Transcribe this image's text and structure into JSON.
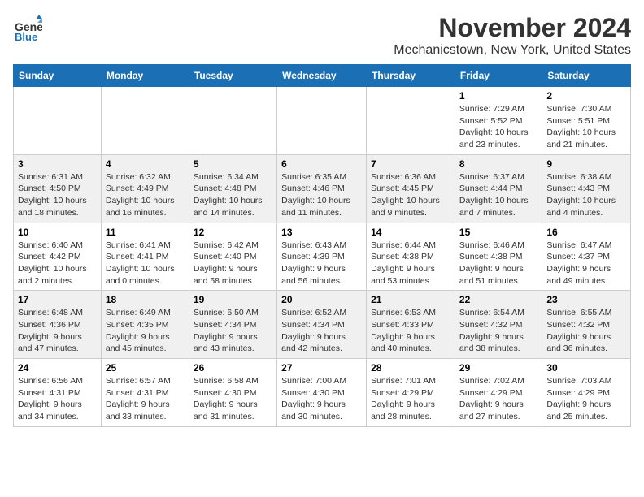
{
  "logo": {
    "line1": "General",
    "line2": "Blue"
  },
  "title": "November 2024",
  "location": "Mechanicstown, New York, United States",
  "weekdays": [
    "Sunday",
    "Monday",
    "Tuesday",
    "Wednesday",
    "Thursday",
    "Friday",
    "Saturday"
  ],
  "weeks": [
    [
      {
        "day": "",
        "info": ""
      },
      {
        "day": "",
        "info": ""
      },
      {
        "day": "",
        "info": ""
      },
      {
        "day": "",
        "info": ""
      },
      {
        "day": "",
        "info": ""
      },
      {
        "day": "1",
        "info": "Sunrise: 7:29 AM\nSunset: 5:52 PM\nDaylight: 10 hours\nand 23 minutes."
      },
      {
        "day": "2",
        "info": "Sunrise: 7:30 AM\nSunset: 5:51 PM\nDaylight: 10 hours\nand 21 minutes."
      }
    ],
    [
      {
        "day": "3",
        "info": "Sunrise: 6:31 AM\nSunset: 4:50 PM\nDaylight: 10 hours\nand 18 minutes."
      },
      {
        "day": "4",
        "info": "Sunrise: 6:32 AM\nSunset: 4:49 PM\nDaylight: 10 hours\nand 16 minutes."
      },
      {
        "day": "5",
        "info": "Sunrise: 6:34 AM\nSunset: 4:48 PM\nDaylight: 10 hours\nand 14 minutes."
      },
      {
        "day": "6",
        "info": "Sunrise: 6:35 AM\nSunset: 4:46 PM\nDaylight: 10 hours\nand 11 minutes."
      },
      {
        "day": "7",
        "info": "Sunrise: 6:36 AM\nSunset: 4:45 PM\nDaylight: 10 hours\nand 9 minutes."
      },
      {
        "day": "8",
        "info": "Sunrise: 6:37 AM\nSunset: 4:44 PM\nDaylight: 10 hours\nand 7 minutes."
      },
      {
        "day": "9",
        "info": "Sunrise: 6:38 AM\nSunset: 4:43 PM\nDaylight: 10 hours\nand 4 minutes."
      }
    ],
    [
      {
        "day": "10",
        "info": "Sunrise: 6:40 AM\nSunset: 4:42 PM\nDaylight: 10 hours\nand 2 minutes."
      },
      {
        "day": "11",
        "info": "Sunrise: 6:41 AM\nSunset: 4:41 PM\nDaylight: 10 hours\nand 0 minutes."
      },
      {
        "day": "12",
        "info": "Sunrise: 6:42 AM\nSunset: 4:40 PM\nDaylight: 9 hours\nand 58 minutes."
      },
      {
        "day": "13",
        "info": "Sunrise: 6:43 AM\nSunset: 4:39 PM\nDaylight: 9 hours\nand 56 minutes."
      },
      {
        "day": "14",
        "info": "Sunrise: 6:44 AM\nSunset: 4:38 PM\nDaylight: 9 hours\nand 53 minutes."
      },
      {
        "day": "15",
        "info": "Sunrise: 6:46 AM\nSunset: 4:38 PM\nDaylight: 9 hours\nand 51 minutes."
      },
      {
        "day": "16",
        "info": "Sunrise: 6:47 AM\nSunset: 4:37 PM\nDaylight: 9 hours\nand 49 minutes."
      }
    ],
    [
      {
        "day": "17",
        "info": "Sunrise: 6:48 AM\nSunset: 4:36 PM\nDaylight: 9 hours\nand 47 minutes."
      },
      {
        "day": "18",
        "info": "Sunrise: 6:49 AM\nSunset: 4:35 PM\nDaylight: 9 hours\nand 45 minutes."
      },
      {
        "day": "19",
        "info": "Sunrise: 6:50 AM\nSunset: 4:34 PM\nDaylight: 9 hours\nand 43 minutes."
      },
      {
        "day": "20",
        "info": "Sunrise: 6:52 AM\nSunset: 4:34 PM\nDaylight: 9 hours\nand 42 minutes."
      },
      {
        "day": "21",
        "info": "Sunrise: 6:53 AM\nSunset: 4:33 PM\nDaylight: 9 hours\nand 40 minutes."
      },
      {
        "day": "22",
        "info": "Sunrise: 6:54 AM\nSunset: 4:32 PM\nDaylight: 9 hours\nand 38 minutes."
      },
      {
        "day": "23",
        "info": "Sunrise: 6:55 AM\nSunset: 4:32 PM\nDaylight: 9 hours\nand 36 minutes."
      }
    ],
    [
      {
        "day": "24",
        "info": "Sunrise: 6:56 AM\nSunset: 4:31 PM\nDaylight: 9 hours\nand 34 minutes."
      },
      {
        "day": "25",
        "info": "Sunrise: 6:57 AM\nSunset: 4:31 PM\nDaylight: 9 hours\nand 33 minutes."
      },
      {
        "day": "26",
        "info": "Sunrise: 6:58 AM\nSunset: 4:30 PM\nDaylight: 9 hours\nand 31 minutes."
      },
      {
        "day": "27",
        "info": "Sunrise: 7:00 AM\nSunset: 4:30 PM\nDaylight: 9 hours\nand 30 minutes."
      },
      {
        "day": "28",
        "info": "Sunrise: 7:01 AM\nSunset: 4:29 PM\nDaylight: 9 hours\nand 28 minutes."
      },
      {
        "day": "29",
        "info": "Sunrise: 7:02 AM\nSunset: 4:29 PM\nDaylight: 9 hours\nand 27 minutes."
      },
      {
        "day": "30",
        "info": "Sunrise: 7:03 AM\nSunset: 4:29 PM\nDaylight: 9 hours\nand 25 minutes."
      }
    ]
  ]
}
